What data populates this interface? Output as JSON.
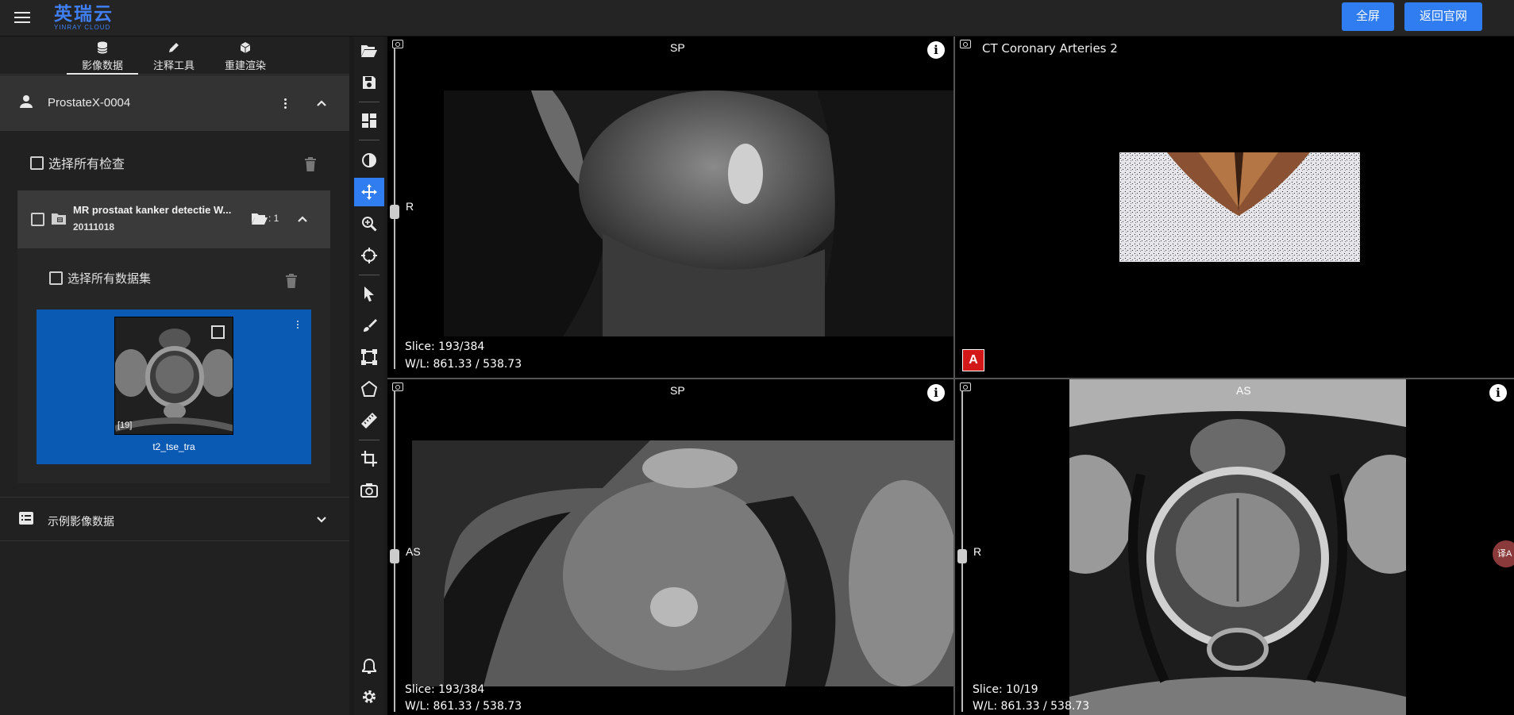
{
  "header": {
    "logo_cn": "英瑞云",
    "logo_en": "YINRAY CLOUD",
    "fullscreen_label": "全屏",
    "official_site_label": "返回官网"
  },
  "tabs": [
    {
      "label": "影像数据",
      "icon": "database-icon",
      "active": true
    },
    {
      "label": "注释工具",
      "icon": "pencil-icon",
      "active": false
    },
    {
      "label": "重建渲染",
      "icon": "cube-icon",
      "active": false
    }
  ],
  "patient": {
    "name": "ProstateX-0004"
  },
  "study": {
    "select_all_label": "选择所有检查",
    "title": "MR prostaat kanker detectie W...",
    "date": "20111018",
    "series_count": ": 1",
    "select_all_datasets_label": "选择所有数据集",
    "series": {
      "count_label": "[19]",
      "name": "t2_tse_tra"
    }
  },
  "example_section": {
    "label": "示例影像数据"
  },
  "toolbar": {
    "tools": [
      "folder-open-icon",
      "save-icon",
      "layout-icon",
      "contrast-icon",
      "move-icon",
      "zoom-icon",
      "crosshair-icon",
      "pointer-icon",
      "brush-icon",
      "select-box-icon",
      "polygon-icon",
      "ruler-icon",
      "crop-icon",
      "camera-rotate-icon",
      "bell-icon",
      "gear-icon"
    ],
    "active_tool": "move-icon"
  },
  "viewports": {
    "top_left": {
      "orient_top": "SP",
      "orient_left": "R",
      "slice": "Slice: 193/384",
      "wl": "W/L: 861.33 / 538.73"
    },
    "top_right": {
      "title": "CT Coronary Arteries 2",
      "badge": "A"
    },
    "bottom_left": {
      "orient_top": "SP",
      "orient_left": "AS",
      "slice": "Slice: 193/384",
      "wl": "W/L: 861.33 / 538.73"
    },
    "bottom_right": {
      "orient_top": "AS",
      "orient_left": "R",
      "slice": "Slice: 10/19",
      "wl": "W/L: 861.33 / 538.73"
    },
    "info_symbol": "i"
  },
  "floating_widget": {
    "label": "译A"
  },
  "colors": {
    "accent": "#2f7df0",
    "selected_series": "#0a5ab4",
    "badge_red": "#d21818"
  }
}
